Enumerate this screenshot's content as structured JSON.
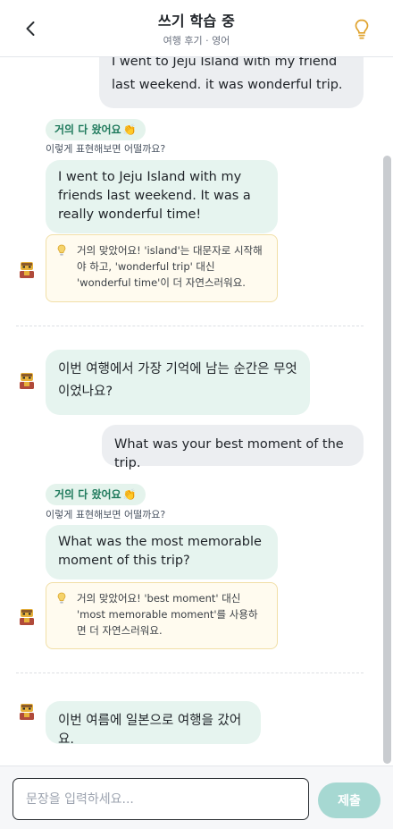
{
  "header": {
    "title": "쓰기 학습 중",
    "subtitle": "여행 후기 · 영어"
  },
  "messages": {
    "user_1": "I went to Jeju Island with my friend last weekend. it was wonderful trip.",
    "badge_1": "거의 다 왔어요",
    "caption_1": "이렇게 표현해보면 어떨까요?",
    "correction_1": "I went to Jeju Island with my friends last weekend. It was a really wonderful time!",
    "feedback_1": "거의 맞았어요! 'island'는 대문자로 시작해야 하고, 'wonderful trip' 대신 'wonderful time'이 더 자연스러워요.",
    "ai_question_1": "이번 여행에서 가장 기억에 남는 순간은 무엇이었나요?",
    "user_2": "What was your best moment of the trip.",
    "badge_2": "거의 다 왔어요",
    "caption_2": "이렇게 표현해보면 어떨까요?",
    "correction_2": "What was the most memorable moment of this trip?",
    "feedback_2": "거의 맞았어요! 'best moment' 대신 'most memorable moment'를 사용하면 더 자연스러워요.",
    "ai_question_2": "이번 여름에 일본으로 여행을 갔어요."
  },
  "composer": {
    "placeholder": "문장을 입력하세요...",
    "submit_label": "제출"
  },
  "icons": {
    "back": "chevron-left-icon",
    "hint": "lightbulb-icon",
    "clap": "👏",
    "avatar": "tutor-avatar-icon"
  },
  "colors": {
    "ai_bubble": "#e6f4ef",
    "user_bubble": "#eceef1",
    "badge_text": "#1f7a5c",
    "feedback_bg": "#fffbef",
    "submit": "#a6d8d2",
    "hint_icon": "#e0a32e"
  }
}
